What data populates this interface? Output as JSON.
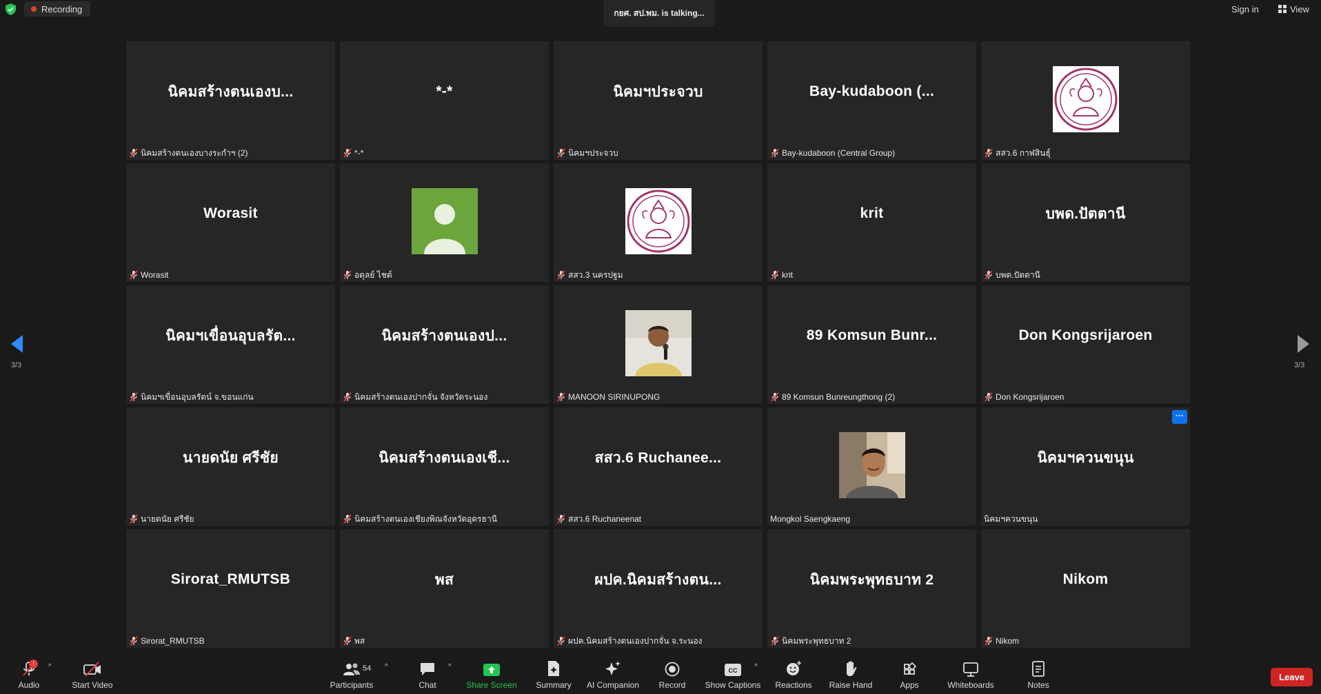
{
  "top": {
    "recording": "Recording",
    "talking": "กยศ. สป.พม. is  talking...",
    "sign_in": "Sign in",
    "view": "View"
  },
  "nav": {
    "left_page": "3/3",
    "right_page": "3/3"
  },
  "tiles": [
    {
      "display": "นิคมสร้างตนเองบ...",
      "label": "นิคมสร้างตนเองบางระกำฯ (2)",
      "muted": true
    },
    {
      "display": "*-*",
      "label": "*-*",
      "muted": true
    },
    {
      "display": "นิคมฯประจวบ",
      "label": "นิคมฯประจวบ",
      "muted": true
    },
    {
      "display": "Bay-kudaboon  (...",
      "label": "Bay-kudaboon (Central Group)",
      "muted": true
    },
    {
      "display": "",
      "label": "สสว.6 กาฬสินธุ์",
      "muted": true,
      "photo": "emblem-avatar"
    },
    {
      "display": "Worasit",
      "label": "Worasit",
      "muted": true
    },
    {
      "display": "",
      "label": "อดุลย์ ไชต์",
      "muted": true,
      "photo": "default-avatar"
    },
    {
      "display": "",
      "label": "สสว.3 นครปฐม",
      "muted": true,
      "photo": "emblem-avatar"
    },
    {
      "display": "krit",
      "label": "krit",
      "muted": true
    },
    {
      "display": "บพด.ปัตตานี",
      "label": "บพด.ปัตตานี",
      "muted": true
    },
    {
      "display": "นิคมฯเขื่อนอุบลรัต...",
      "label": "นิคมฯเขื่อนอุบลรัตน์ จ.ขอนแก่น",
      "muted": true
    },
    {
      "display": "นิคมสร้างตนเองป...",
      "label": "นิคมสร้างตนเองปากจั่น จังหวัดระนอง",
      "muted": true
    },
    {
      "display": "",
      "label": "MANOON SIRINUPONG",
      "muted": true,
      "photo": "man-microphone-photo"
    },
    {
      "display": "89  Komsun  Bunr...",
      "label": "89 Komsun Bunreungthong (2)",
      "muted": true
    },
    {
      "display": "Don Kongsrijaroen",
      "label": "Don Kongsrijaroen",
      "muted": true
    },
    {
      "display": "นายดนัย  ศรีชัย",
      "label": "นายดนัย ศรีชัย",
      "muted": true
    },
    {
      "display": "นิคมสร้างตนเองเชี...",
      "label": "นิคมสร้างตนเองเชียงพิณจังหวัดอุดรธานี",
      "muted": true
    },
    {
      "display": "สสว.6  Ruchanee...",
      "label": "สสว.6 Ruchaneenat",
      "muted": true
    },
    {
      "display": "",
      "label": "Mongkol Saengkaeng",
      "muted": false,
      "photo": "man-selfie-photo"
    },
    {
      "display": "นิคมฯควนขนุน",
      "label": "นิคมฯควนขนุน",
      "muted": false,
      "more": "···"
    },
    {
      "display": "Sirorat_RMUTSB",
      "label": "Sirorat_RMUTSB",
      "muted": true
    },
    {
      "display": "พส",
      "label": "พส",
      "muted": true
    },
    {
      "display": "ผปค.นิคมสร้างตน...",
      "label": "ผปค.นิคมสร้างตนเองปากจั่น จ.ระนอง",
      "muted": true
    },
    {
      "display": "นิคมพระพุทธบาท 2",
      "label": "นิคมพระพุทธบาท 2",
      "muted": true
    },
    {
      "display": "Nikom",
      "label": "Nikom",
      "muted": true
    }
  ],
  "toolbar": {
    "audio": "Audio",
    "start_video": "Start Video",
    "participants": "Participants",
    "participant_count": "54",
    "chat": "Chat",
    "share_screen": "Share Screen",
    "summary": "Summary",
    "ai_companion": "AI Companion",
    "record": "Record",
    "show_captions": "Show Captions",
    "reactions": "Reactions",
    "raise_hand": "Raise Hand",
    "apps": "Apps",
    "whiteboards": "Whiteboards",
    "notes": "Notes",
    "leave": "Leave",
    "audio_badge": "!"
  },
  "colors": {
    "background": "#1a1a1a",
    "tile": "#262626",
    "share_green": "#23c552",
    "leave_red": "#cf2424",
    "accent_blue": "#0e72ed"
  }
}
